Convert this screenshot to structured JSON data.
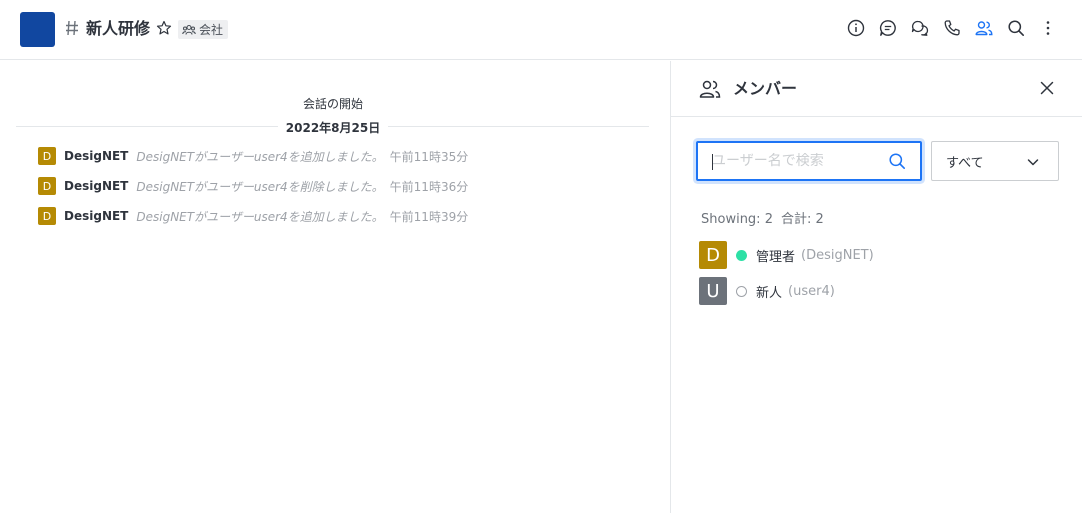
{
  "header": {
    "room_name": "新人研修",
    "team_label": "会社",
    "room_avatar_color": "#1147a0"
  },
  "main": {
    "start_text": "会話の開始",
    "date": "2022年8月25日",
    "messages": [
      {
        "avatar": "D",
        "user": "DesigNET",
        "text": "DesigNETがユーザーuser4を追加しました。",
        "time": "午前11時35分"
      },
      {
        "avatar": "D",
        "user": "DesigNET",
        "text": "DesigNETがユーザーuser4を削除しました。",
        "time": "午前11時36分"
      },
      {
        "avatar": "D",
        "user": "DesigNET",
        "text": "DesigNETがユーザーuser4を追加しました。",
        "time": "午前11時39分"
      }
    ]
  },
  "panel": {
    "title": "メンバー",
    "search_placeholder": "ユーザー名で検索",
    "filter_value": "すべて",
    "showing_label": "Showing: 2",
    "total_label": "合計: 2",
    "members": [
      {
        "avatar": "D",
        "avatar_color": "#b58a04",
        "name": "管理者",
        "username": "(DesigNET)",
        "status": "online",
        "status_color": "#2de0a5"
      },
      {
        "avatar": "U",
        "avatar_color": "#6c727a",
        "name": "新人",
        "username": "(user4)",
        "status": "offline",
        "status_color": "#9ea2a8"
      }
    ]
  },
  "colors": {
    "accent": "#1d74f5",
    "message_avatar": "#b58a04"
  }
}
